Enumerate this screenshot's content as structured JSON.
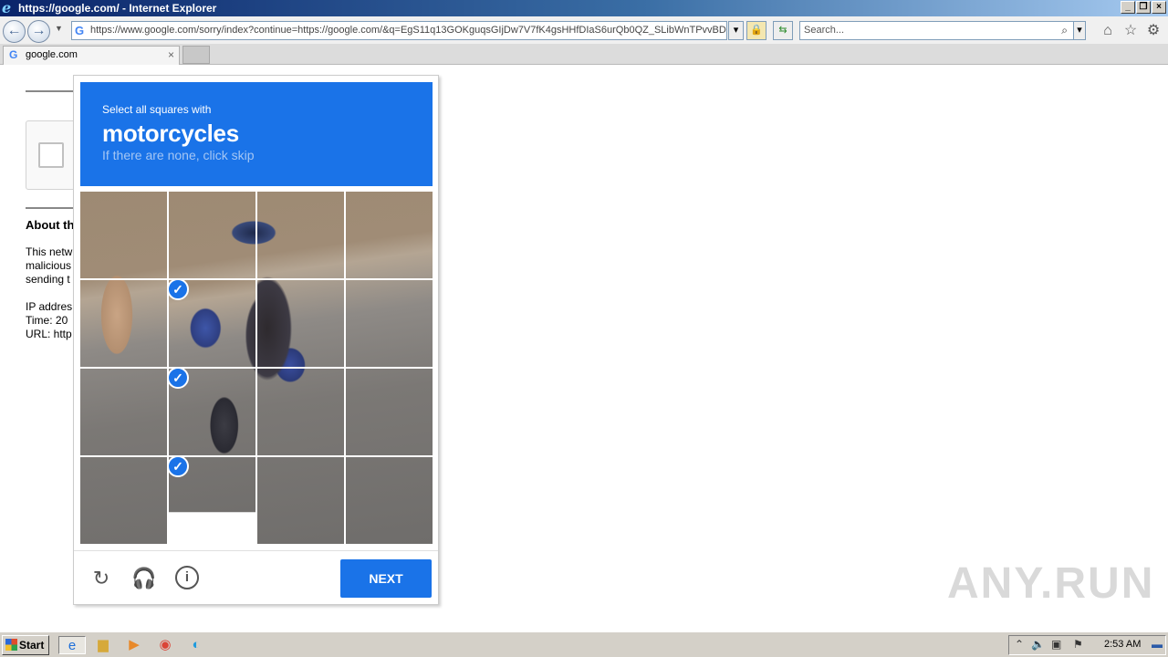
{
  "window": {
    "title": "https://google.com/ - Internet Explorer"
  },
  "address_bar": {
    "url": "https://www.google.com/sorry/index?continue=https://google.com/&q=EgS11q13GOKguqsGIjDw7V7fK4gsHHfDIaS6urQb0QZ_SLibWnTPvvBDwE"
  },
  "search": {
    "placeholder": "Search..."
  },
  "tab": {
    "label": "google.com"
  },
  "background_page": {
    "about_heading": "About th",
    "body_lines": [
      "This netw",
      "malicious",
      "sending t"
    ],
    "info_lines": [
      "IP addres",
      "Time: 20",
      "URL: http"
    ]
  },
  "captcha": {
    "instruction": "Select all squares with",
    "target": "motorcycles",
    "hint": "If there are none, click skip",
    "selected_tiles": [
      5,
      9,
      13
    ],
    "next_label": "NEXT",
    "icons": [
      "reload-icon",
      "audio-icon",
      "info-icon"
    ]
  },
  "watermark": {
    "text": "ANY.RUN"
  },
  "taskbar": {
    "start_label": "Start",
    "clock": "2:53 AM"
  }
}
